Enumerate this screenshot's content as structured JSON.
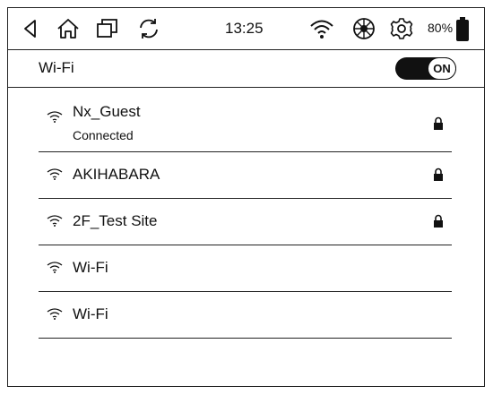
{
  "statusbar": {
    "icons": [
      "back-icon",
      "home-icon",
      "multitask-icon",
      "refresh-icon",
      "wifi-icon",
      "aperture-icon",
      "gear-icon"
    ],
    "time": "13:25",
    "battery": "80%",
    "battery_icon": "battery-icon"
  },
  "wifi": {
    "title": "Wi-Fi",
    "toggle_label": "ON",
    "toggle_state": true
  },
  "networks": [
    {
      "ssid": "Nx_Guest",
      "status": "Connected",
      "secured": true,
      "icon": "wifi-signal-icon"
    },
    {
      "ssid": "AKIHABARA",
      "status": "",
      "secured": true,
      "icon": "wifi-signal-icon"
    },
    {
      "ssid": "2F_Test Site",
      "status": "",
      "secured": true,
      "icon": "wifi-signal-icon"
    },
    {
      "ssid": "Wi-Fi",
      "status": "",
      "secured": false,
      "icon": "wifi-signal-icon"
    },
    {
      "ssid": "Wi-Fi",
      "status": "",
      "secured": false,
      "icon": "wifi-signal-icon"
    }
  ],
  "colors": {
    "ink": "#111111",
    "background": "#ffffff"
  }
}
